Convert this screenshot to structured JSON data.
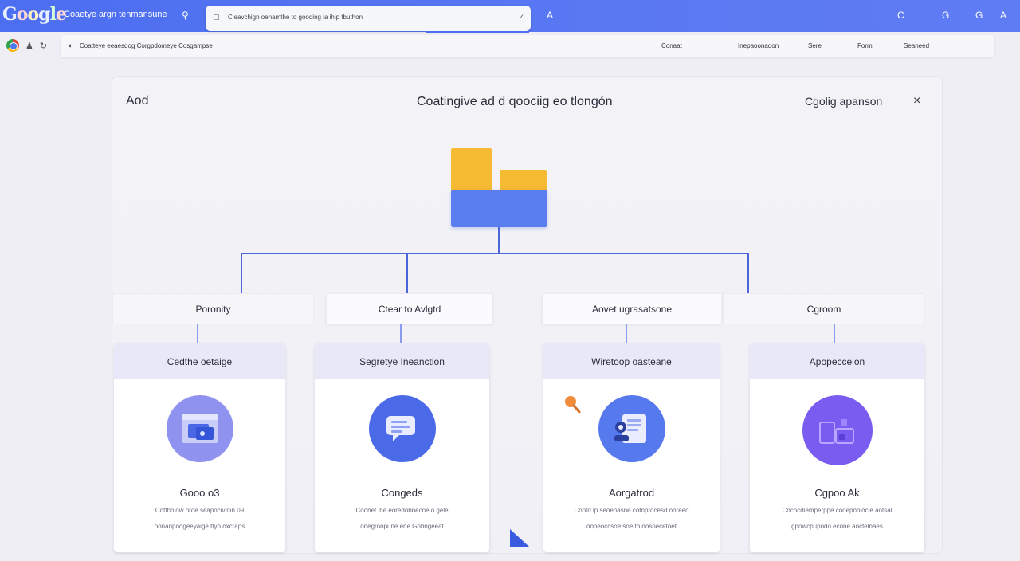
{
  "topbar": {
    "logo_letters": [
      "G",
      "o",
      "o",
      "g",
      "l",
      "e"
    ],
    "app_title": "Coaetye argn tenmansune",
    "search_placeholder": "Cleavchign oenamthe to gooding ia ihip tbuthon",
    "tab_letter": "A",
    "right_icons": [
      "C",
      "G",
      "G",
      "A"
    ]
  },
  "address": {
    "url": "Coatteye eeaesdog Corgpdomeye Cosgampse",
    "links": [
      "Conaat",
      "Inepaoonadon",
      "Sere",
      "Form",
      "Seaneed"
    ]
  },
  "modal": {
    "left_label": "Aod",
    "title": "Coatingive ad d qoociig eo tlongón",
    "right_label": "Cgolig apanson",
    "close_label": "×"
  },
  "sections": [
    {
      "label": "Poronity"
    },
    {
      "label": "Ctear to Avlgtd"
    },
    {
      "label": "Aovet ugrasatsone"
    },
    {
      "label": "Cgroom"
    }
  ],
  "cards": [
    {
      "header": "Cedthe oetaige",
      "name": "Gooo o3",
      "desc_line1": "Cotthoiow oroe seapocivinin 09",
      "desc_line2": "oonanpoogeeyaige ttyo oxcraps",
      "icon": "browser-window-icon",
      "icon_color": "#8f92ee"
    },
    {
      "header": "Segretye Ineanction",
      "name": "Congeds",
      "desc_line1": "Coonet lhe eoredobnecoe o gele",
      "desc_line2": "onegroopune ene Gobngeeat",
      "icon": "chat-document-icon",
      "icon_color": "#4a6ae8"
    },
    {
      "header": "Wiretoop oasteane",
      "name": "Aorgatrod",
      "desc_line1": "Coptd lp seoenasne cotnprocesd ooreed",
      "desc_line2": "oopeoccsoe soe tb oosoecetoet",
      "icon": "document-person-icon",
      "icon_color": "#5679ee"
    },
    {
      "header": "Apopeccelon",
      "name": "Cgpoo Ak",
      "desc_line1": "Cococdiemperppe cooepooiocie aotsal",
      "desc_line2": "gpowcpupodo econe aoctelnaes",
      "icon": "blocks-icon",
      "icon_color": "#7a5cf0"
    }
  ],
  "colors": {
    "topbar": "#4c6ef0",
    "folder_yellow": "#f6b932",
    "folder_blue": "#5a7df0",
    "connector": "#4a66d8",
    "card_header": "#e9e8f8",
    "pin_orange": "#f08c3a"
  }
}
